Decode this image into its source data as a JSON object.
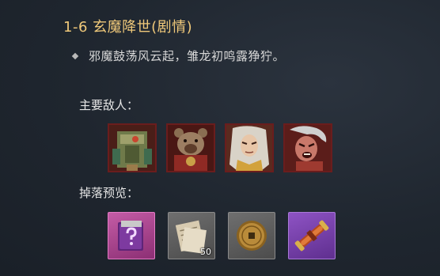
{
  "stage": {
    "title": "1-6 玄魔降世(剧情)",
    "description": "邪魔鼓荡风云起，雏龙初鸣露狰狞。"
  },
  "enemies": {
    "label": "主要敌人：",
    "items": [
      {
        "icon": "armored-construct-portrait-icon"
      },
      {
        "icon": "bear-warrior-portrait-icon"
      },
      {
        "icon": "white-haired-sage-portrait-icon"
      },
      {
        "icon": "screaming-demon-portrait-icon"
      }
    ]
  },
  "drops": {
    "label": "掉落预览：",
    "items": [
      {
        "icon": "mystery-book-icon",
        "rarity_color": "#c45ca6",
        "count": ""
      },
      {
        "icon": "scroll-papers-icon",
        "rarity_color": "#6f6f6f",
        "count": "50"
      },
      {
        "icon": "bronze-coin-icon",
        "rarity_color": "#6f6f6f",
        "count": ""
      },
      {
        "icon": "sealed-scroll-icon",
        "rarity_color": "#8e53c4",
        "count": ""
      }
    ]
  },
  "colors": {
    "title": "#f0c97a",
    "enemy_frame": "#6a1d1d"
  }
}
